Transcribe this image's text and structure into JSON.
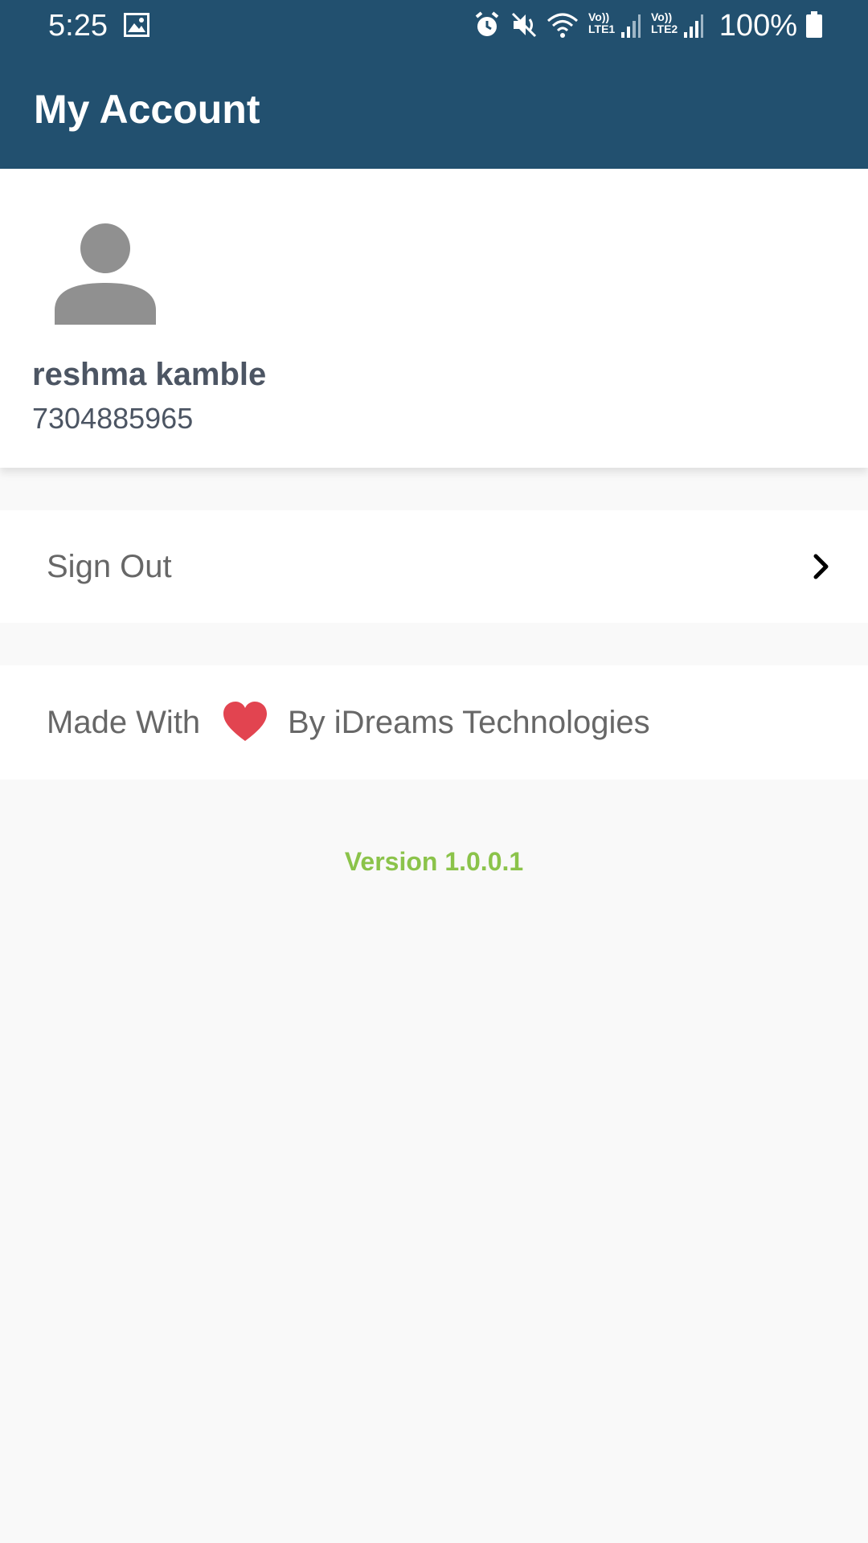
{
  "status_bar": {
    "time": "5:25",
    "battery_percent": "100%",
    "sim1_top": "Vo))",
    "sim1_bottom": "LTE1",
    "sim2_top": "Vo))",
    "sim2_bottom": "LTE2",
    "icons": [
      "gallery-icon",
      "alarm-icon",
      "mute-icon",
      "wifi-icon",
      "signal-icon",
      "battery-icon"
    ]
  },
  "app_bar": {
    "title": "My Account"
  },
  "profile": {
    "name": "reshma kamble",
    "phone": "7304885965"
  },
  "menu": {
    "sign_out_label": "Sign Out"
  },
  "footer": {
    "made_with": "Made With",
    "by": "By iDreams Technologies",
    "version": "Version 1.0.0.1"
  },
  "colors": {
    "primary": "#22506f",
    "accent_green": "#8bc34a",
    "heart_red": "#e24450",
    "text_gray": "#676767"
  }
}
